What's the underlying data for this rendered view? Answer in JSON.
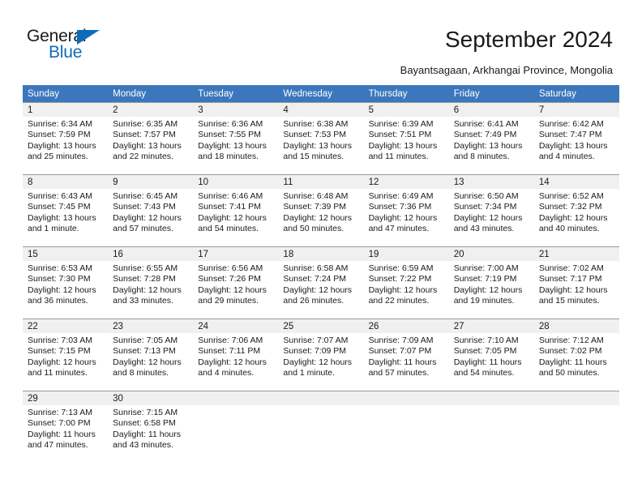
{
  "brand": {
    "name_part1": "General",
    "name_part2": "Blue",
    "accent_color": "#0d6cb9",
    "triangle_icon": "brand-triangle-icon"
  },
  "header": {
    "title": "September 2024",
    "subtitle": "Bayantsagaan, Arkhangai Province, Mongolia"
  },
  "calendar": {
    "header_background": "#3b77bc",
    "daynum_background": "#f0f0f0",
    "weekdays": [
      "Sunday",
      "Monday",
      "Tuesday",
      "Wednesday",
      "Thursday",
      "Friday",
      "Saturday"
    ],
    "weeks": [
      [
        {
          "day": "1",
          "sunrise": "Sunrise: 6:34 AM",
          "sunset": "Sunset: 7:59 PM",
          "daylight": "Daylight: 13 hours and 25 minutes."
        },
        {
          "day": "2",
          "sunrise": "Sunrise: 6:35 AM",
          "sunset": "Sunset: 7:57 PM",
          "daylight": "Daylight: 13 hours and 22 minutes."
        },
        {
          "day": "3",
          "sunrise": "Sunrise: 6:36 AM",
          "sunset": "Sunset: 7:55 PM",
          "daylight": "Daylight: 13 hours and 18 minutes."
        },
        {
          "day": "4",
          "sunrise": "Sunrise: 6:38 AM",
          "sunset": "Sunset: 7:53 PM",
          "daylight": "Daylight: 13 hours and 15 minutes."
        },
        {
          "day": "5",
          "sunrise": "Sunrise: 6:39 AM",
          "sunset": "Sunset: 7:51 PM",
          "daylight": "Daylight: 13 hours and 11 minutes."
        },
        {
          "day": "6",
          "sunrise": "Sunrise: 6:41 AM",
          "sunset": "Sunset: 7:49 PM",
          "daylight": "Daylight: 13 hours and 8 minutes."
        },
        {
          "day": "7",
          "sunrise": "Sunrise: 6:42 AM",
          "sunset": "Sunset: 7:47 PM",
          "daylight": "Daylight: 13 hours and 4 minutes."
        }
      ],
      [
        {
          "day": "8",
          "sunrise": "Sunrise: 6:43 AM",
          "sunset": "Sunset: 7:45 PM",
          "daylight": "Daylight: 13 hours and 1 minute."
        },
        {
          "day": "9",
          "sunrise": "Sunrise: 6:45 AM",
          "sunset": "Sunset: 7:43 PM",
          "daylight": "Daylight: 12 hours and 57 minutes."
        },
        {
          "day": "10",
          "sunrise": "Sunrise: 6:46 AM",
          "sunset": "Sunset: 7:41 PM",
          "daylight": "Daylight: 12 hours and 54 minutes."
        },
        {
          "day": "11",
          "sunrise": "Sunrise: 6:48 AM",
          "sunset": "Sunset: 7:39 PM",
          "daylight": "Daylight: 12 hours and 50 minutes."
        },
        {
          "day": "12",
          "sunrise": "Sunrise: 6:49 AM",
          "sunset": "Sunset: 7:36 PM",
          "daylight": "Daylight: 12 hours and 47 minutes."
        },
        {
          "day": "13",
          "sunrise": "Sunrise: 6:50 AM",
          "sunset": "Sunset: 7:34 PM",
          "daylight": "Daylight: 12 hours and 43 minutes."
        },
        {
          "day": "14",
          "sunrise": "Sunrise: 6:52 AM",
          "sunset": "Sunset: 7:32 PM",
          "daylight": "Daylight: 12 hours and 40 minutes."
        }
      ],
      [
        {
          "day": "15",
          "sunrise": "Sunrise: 6:53 AM",
          "sunset": "Sunset: 7:30 PM",
          "daylight": "Daylight: 12 hours and 36 minutes."
        },
        {
          "day": "16",
          "sunrise": "Sunrise: 6:55 AM",
          "sunset": "Sunset: 7:28 PM",
          "daylight": "Daylight: 12 hours and 33 minutes."
        },
        {
          "day": "17",
          "sunrise": "Sunrise: 6:56 AM",
          "sunset": "Sunset: 7:26 PM",
          "daylight": "Daylight: 12 hours and 29 minutes."
        },
        {
          "day": "18",
          "sunrise": "Sunrise: 6:58 AM",
          "sunset": "Sunset: 7:24 PM",
          "daylight": "Daylight: 12 hours and 26 minutes."
        },
        {
          "day": "19",
          "sunrise": "Sunrise: 6:59 AM",
          "sunset": "Sunset: 7:22 PM",
          "daylight": "Daylight: 12 hours and 22 minutes."
        },
        {
          "day": "20",
          "sunrise": "Sunrise: 7:00 AM",
          "sunset": "Sunset: 7:19 PM",
          "daylight": "Daylight: 12 hours and 19 minutes."
        },
        {
          "day": "21",
          "sunrise": "Sunrise: 7:02 AM",
          "sunset": "Sunset: 7:17 PM",
          "daylight": "Daylight: 12 hours and 15 minutes."
        }
      ],
      [
        {
          "day": "22",
          "sunrise": "Sunrise: 7:03 AM",
          "sunset": "Sunset: 7:15 PM",
          "daylight": "Daylight: 12 hours and 11 minutes."
        },
        {
          "day": "23",
          "sunrise": "Sunrise: 7:05 AM",
          "sunset": "Sunset: 7:13 PM",
          "daylight": "Daylight: 12 hours and 8 minutes."
        },
        {
          "day": "24",
          "sunrise": "Sunrise: 7:06 AM",
          "sunset": "Sunset: 7:11 PM",
          "daylight": "Daylight: 12 hours and 4 minutes."
        },
        {
          "day": "25",
          "sunrise": "Sunrise: 7:07 AM",
          "sunset": "Sunset: 7:09 PM",
          "daylight": "Daylight: 12 hours and 1 minute."
        },
        {
          "day": "26",
          "sunrise": "Sunrise: 7:09 AM",
          "sunset": "Sunset: 7:07 PM",
          "daylight": "Daylight: 11 hours and 57 minutes."
        },
        {
          "day": "27",
          "sunrise": "Sunrise: 7:10 AM",
          "sunset": "Sunset: 7:05 PM",
          "daylight": "Daylight: 11 hours and 54 minutes."
        },
        {
          "day": "28",
          "sunrise": "Sunrise: 7:12 AM",
          "sunset": "Sunset: 7:02 PM",
          "daylight": "Daylight: 11 hours and 50 minutes."
        }
      ],
      [
        {
          "day": "29",
          "sunrise": "Sunrise: 7:13 AM",
          "sunset": "Sunset: 7:00 PM",
          "daylight": "Daylight: 11 hours and 47 minutes."
        },
        {
          "day": "30",
          "sunrise": "Sunrise: 7:15 AM",
          "sunset": "Sunset: 6:58 PM",
          "daylight": "Daylight: 11 hours and 43 minutes."
        },
        {
          "day": "",
          "sunrise": "",
          "sunset": "",
          "daylight": ""
        },
        {
          "day": "",
          "sunrise": "",
          "sunset": "",
          "daylight": ""
        },
        {
          "day": "",
          "sunrise": "",
          "sunset": "",
          "daylight": ""
        },
        {
          "day": "",
          "sunrise": "",
          "sunset": "",
          "daylight": ""
        },
        {
          "day": "",
          "sunrise": "",
          "sunset": "",
          "daylight": ""
        }
      ]
    ]
  }
}
